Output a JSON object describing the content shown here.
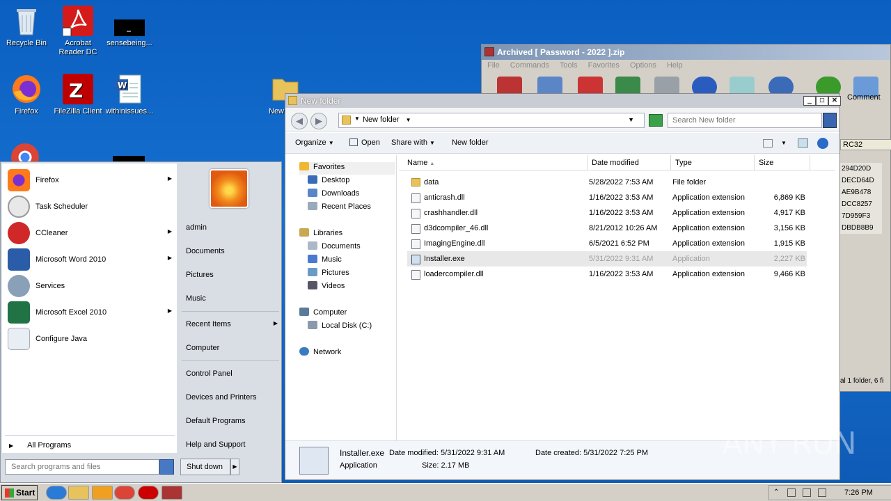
{
  "desktop": {
    "icons": [
      {
        "label": "Recycle Bin",
        "icon": "recycle-bin-icon"
      },
      {
        "label": "Acrobat Reader DC",
        "label2": "Reader DC",
        "label1": "Acrobat",
        "icon": "acrobat-icon"
      },
      {
        "label": "sensebeing...",
        "icon": "console-icon"
      },
      {
        "label": "Firefox",
        "icon": "firefox-icon"
      },
      {
        "label": "FileZilla Client",
        "icon": "filezilla-icon"
      },
      {
        "label": "withinissues...",
        "icon": "word-doc-icon"
      },
      {
        "label": "New",
        "icon": "folder-icon"
      }
    ]
  },
  "zip_window": {
    "title": "Archived [ Password - 2022 ].zip",
    "menu": [
      "File",
      "Commands",
      "Tools",
      "Favorites",
      "Options",
      "Help"
    ],
    "comment_label": "Comment",
    "crc_header": "RC32",
    "crc_values": [
      "294D20D",
      "DECD64D",
      "AE9B478",
      "DCC8257",
      "7D959F3",
      "DBDB8B9"
    ],
    "status": "al 1 folder, 6 fi"
  },
  "explorer": {
    "title": "New folder",
    "address": "New folder",
    "search_placeholder": "Search New folder",
    "toolbar": {
      "organize": "Organize",
      "open": "Open",
      "share_with": "Share with",
      "new_folder": "New folder"
    },
    "nav": {
      "favorites": "Favorites",
      "desktop": "Desktop",
      "downloads": "Downloads",
      "recent_places": "Recent Places",
      "libraries": "Libraries",
      "documents": "Documents",
      "music": "Music",
      "pictures": "Pictures",
      "videos": "Videos",
      "computer": "Computer",
      "local_disk": "Local Disk (C:)",
      "network": "Network"
    },
    "columns": {
      "name": "Name",
      "date": "Date modified",
      "type": "Type",
      "size": "Size"
    },
    "files": [
      {
        "name": "data",
        "date": "5/28/2022 7:53 AM",
        "type": "File folder",
        "size": ""
      },
      {
        "name": "anticrash.dll",
        "date": "1/16/2022 3:53 AM",
        "type": "Application extension",
        "size": "6,869 KB"
      },
      {
        "name": "crashhandler.dll",
        "date": "1/16/2022 3:53 AM",
        "type": "Application extension",
        "size": "4,917 KB"
      },
      {
        "name": "d3dcompiler_46.dll",
        "date": "8/21/2012 10:26 AM",
        "type": "Application extension",
        "size": "3,156 KB"
      },
      {
        "name": "ImagingEngine.dll",
        "date": "6/5/2021 6:52 PM",
        "type": "Application extension",
        "size": "1,915 KB"
      },
      {
        "name": "Installer.exe",
        "date": "5/31/2022 9:31 AM",
        "type": "Application",
        "size": "2,227 KB"
      },
      {
        "name": "loadercompiler.dll",
        "date": "1/16/2022 3:53 AM",
        "type": "Application extension",
        "size": "9,466 KB"
      }
    ],
    "details": {
      "name": "Installer.exe",
      "date_modified": "Date modified: 5/31/2022 9:31 AM",
      "date_created": "Date created: 5/31/2022 7:25 PM",
      "kind": "Application",
      "size": "Size: 2.17 MB"
    }
  },
  "start_menu": {
    "programs": [
      {
        "label": "Firefox",
        "arrow": true
      },
      {
        "label": "Task Scheduler",
        "arrow": false
      },
      {
        "label": "CCleaner",
        "arrow": true
      },
      {
        "label": "Microsoft Word 2010",
        "arrow": true
      },
      {
        "label": "Services",
        "arrow": false
      },
      {
        "label": "Microsoft Excel 2010",
        "arrow": true
      },
      {
        "label": "Configure Java",
        "arrow": false
      }
    ],
    "all_programs": "All Programs",
    "search_placeholder": "Search programs and files",
    "right": {
      "user": "admin",
      "documents": "Documents",
      "pictures": "Pictures",
      "music": "Music",
      "recent_items": "Recent Items",
      "computer": "Computer",
      "control_panel": "Control Panel",
      "devices_printers": "Devices and Printers",
      "default_programs": "Default Programs",
      "help_support": "Help and Support"
    },
    "shutdown": "Shut down"
  },
  "taskbar": {
    "start": "Start",
    "clock": "7:26 PM"
  },
  "watermark": "ANY RUN"
}
